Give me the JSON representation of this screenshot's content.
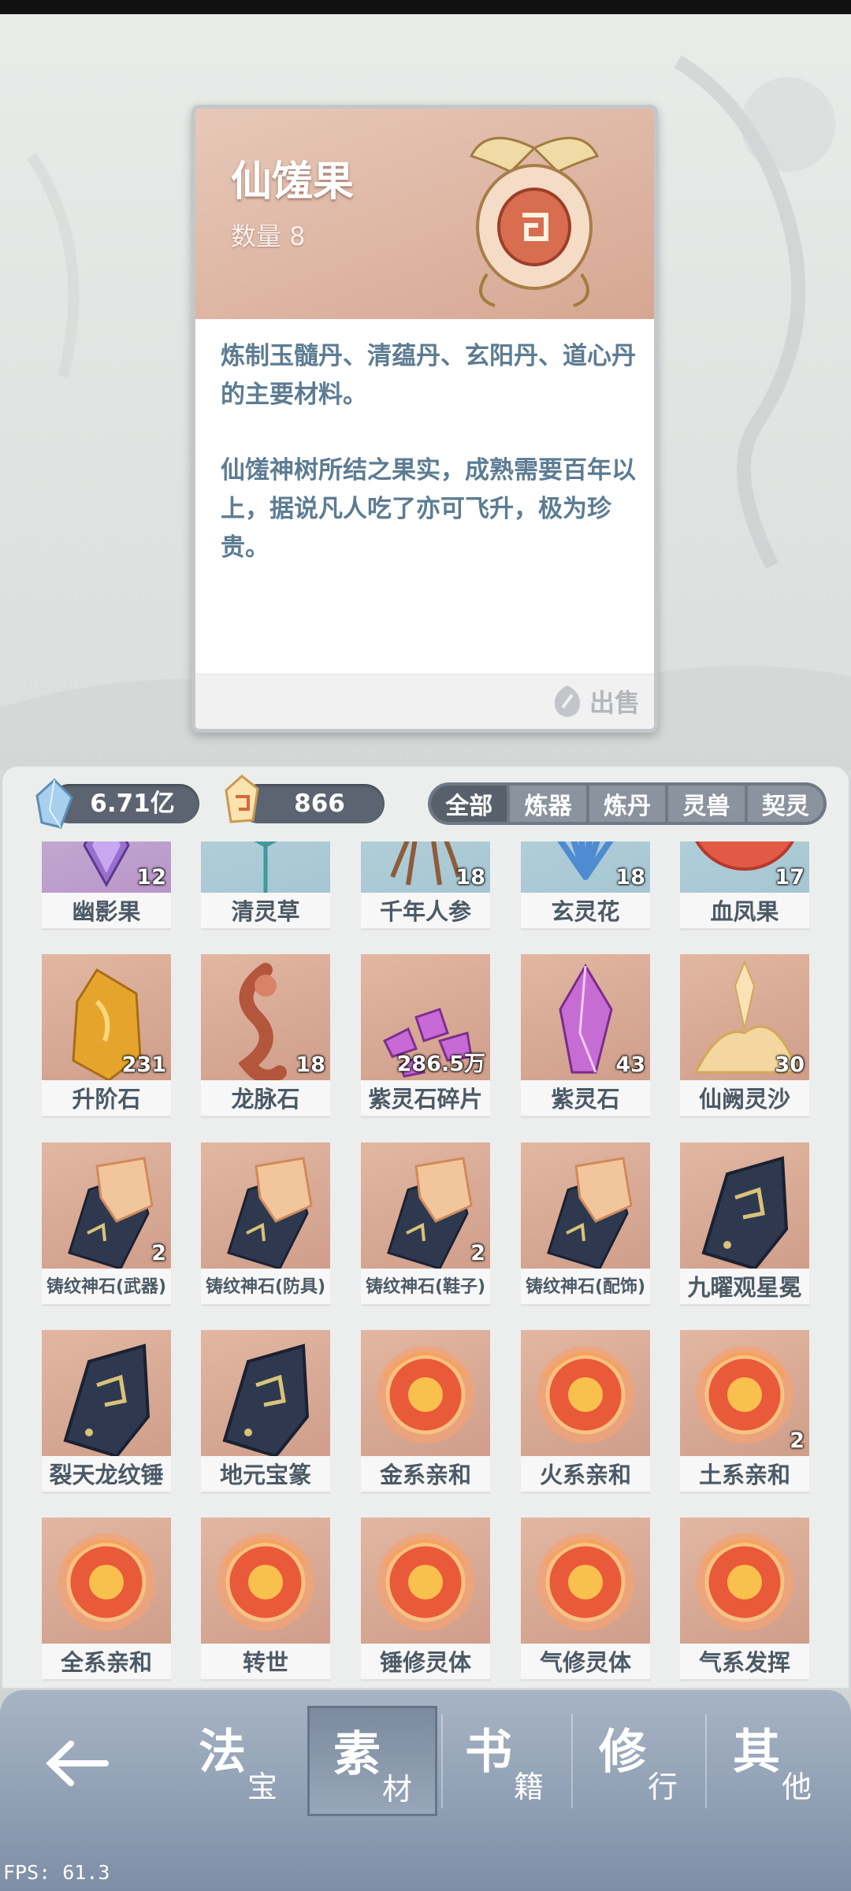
{
  "detail": {
    "name": "仙馐果",
    "count_label": "数量 8",
    "description_1": "炼制玉髓丹、清蕴丹、玄阳丹、道心丹的主要材料。",
    "description_2": "仙馐神树所结之果实，成熟需要百年以上，据说凡人吃了亦可飞升，极为珍贵。",
    "sell_label": "出售"
  },
  "currency": {
    "spirit_stone": "6.71亿",
    "gold_gem": "866"
  },
  "filters": [
    "全部",
    "炼器",
    "炼丹",
    "灵兽",
    "契灵"
  ],
  "items": [
    {
      "name": "幽影果",
      "count": "12",
      "icon": "purple-flower-icon"
    },
    {
      "name": "清灵草",
      "count": "",
      "icon": "herb-icon"
    },
    {
      "name": "千年人参",
      "count": "18",
      "icon": "ginseng-icon"
    },
    {
      "name": "玄灵花",
      "count": "18",
      "icon": "blue-flower-icon"
    },
    {
      "name": "血凤果",
      "count": "17",
      "icon": "red-fruit-icon"
    },
    {
      "name": "升阶石",
      "count": "231",
      "icon": "amber-stone-icon"
    },
    {
      "name": "龙脉石",
      "count": "18",
      "icon": "dragon-vein-icon"
    },
    {
      "name": "紫灵石碎片",
      "count": "286.5万",
      "icon": "purple-shards-icon"
    },
    {
      "name": "紫灵石",
      "count": "43",
      "icon": "purple-crystal-icon"
    },
    {
      "name": "仙阙灵沙",
      "count": "30",
      "icon": "golden-sand-icon"
    },
    {
      "name": "铸纹神石(武器)",
      "count": "2",
      "icon": "rune-stone-icon"
    },
    {
      "name": "铸纹神石(防具)",
      "count": "",
      "icon": "rune-stone-icon"
    },
    {
      "name": "铸纹神石(鞋子)",
      "count": "2",
      "icon": "rune-stone-icon"
    },
    {
      "name": "铸纹神石(配饰)",
      "count": "",
      "icon": "rune-stone-icon"
    },
    {
      "name": "九曜观星冕",
      "count": "",
      "icon": "dark-rune-icon"
    },
    {
      "name": "裂天龙纹锤",
      "count": "",
      "icon": "dark-rune-icon"
    },
    {
      "name": "地元宝篆",
      "count": "",
      "icon": "dark-rune-icon"
    },
    {
      "name": "金系亲和",
      "count": "",
      "icon": "fire-orb-icon"
    },
    {
      "name": "火系亲和",
      "count": "",
      "icon": "fire-orb-icon"
    },
    {
      "name": "土系亲和",
      "count": "2",
      "icon": "fire-orb-icon"
    },
    {
      "name": "全系亲和",
      "count": "",
      "icon": "fire-orb-icon"
    },
    {
      "name": "转世",
      "count": "",
      "icon": "fire-orb-icon"
    },
    {
      "name": "锤修灵体",
      "count": "",
      "icon": "fire-orb-icon"
    },
    {
      "name": "气修灵体",
      "count": "",
      "icon": "fire-orb-icon"
    },
    {
      "name": "气系发挥",
      "count": "",
      "icon": "fire-orb-icon"
    }
  ],
  "nav": {
    "tabs": [
      {
        "big": "法",
        "small": "宝"
      },
      {
        "big": "素",
        "small": "材"
      },
      {
        "big": "书",
        "small": "籍"
      },
      {
        "big": "修",
        "small": "行"
      },
      {
        "big": "其",
        "small": "他"
      }
    ],
    "active_index": 1
  },
  "fps": "FPS: 61.3"
}
